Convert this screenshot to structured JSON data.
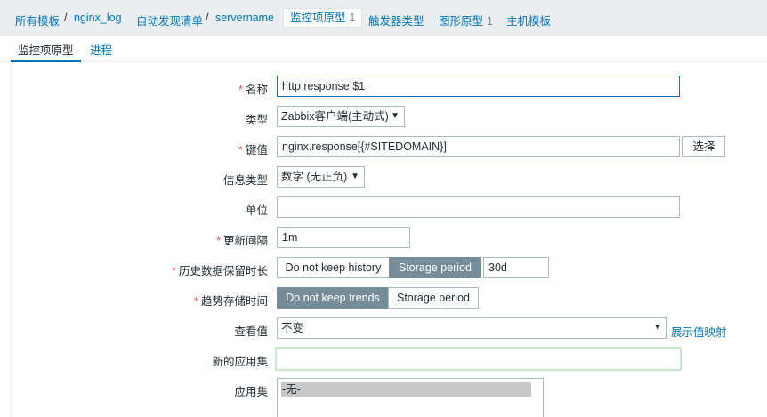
{
  "breadcrumbs": {
    "templates": "所有模板",
    "sep1": "/",
    "host": "nginx_log",
    "discovery": "自动发现清单",
    "sep2": "/",
    "rule": "servername",
    "item_prototypes": "监控项原型",
    "item_prototypes_count": "1",
    "trigger_types": "触发器类型",
    "graph_prototypes": "图形原型",
    "graph_prototypes_count": "1",
    "host_templates": "主机模板"
  },
  "tabs": {
    "item_prototype": "监控项原型",
    "process": "进程"
  },
  "form": {
    "name_label": "名称",
    "name_value": "http response $1",
    "type_label": "类型",
    "type_value": "Zabbix客户端(主动式)",
    "key_label": "键值",
    "key_value": "nginx.response[{#SITEDOMAIN}]",
    "key_select_button": "选择",
    "info_type_label": "信息类型",
    "info_type_value": "数字 (无正负)",
    "units_label": "单位",
    "units_value": "",
    "interval_label": "更新间隔",
    "interval_value": "1m",
    "history_label": "历史数据保留时长",
    "history_no_keep": "Do not keep history",
    "history_storage": "Storage period",
    "history_value": "30d",
    "trends_label": "趋势存储时间",
    "trends_no_keep": "Do not keep trends",
    "trends_storage": "Storage period",
    "show_value_label": "查看值",
    "show_value_value": "不变",
    "show_value_mapping_link": "展示值映射",
    "new_app_label": "新的应用集",
    "new_app_value": "",
    "apps_label": "应用集",
    "apps_options": [
      "-无-"
    ],
    "required_mark": "*"
  },
  "colors": {
    "link": "#0275b8",
    "required": "#e45959",
    "segment_active": "#768d99",
    "background": "#ebeef0"
  },
  "icons": {
    "dropdown": "caret-down-icon"
  }
}
